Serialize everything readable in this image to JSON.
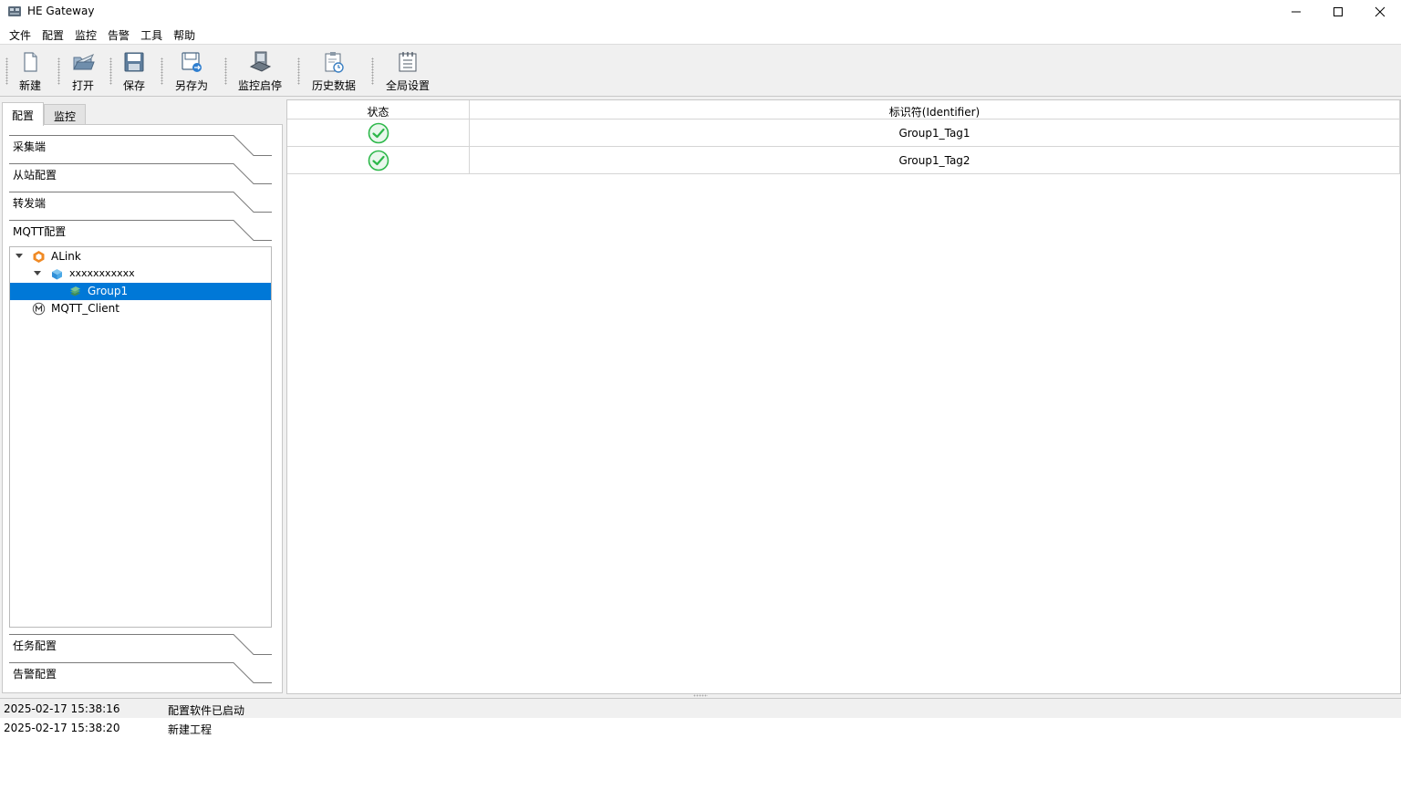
{
  "window": {
    "title": "HE Gateway"
  },
  "menu": [
    "文件",
    "配置",
    "监控",
    "告警",
    "工具",
    "帮助"
  ],
  "toolbar": [
    {
      "label": "新建",
      "icon": "new-file-icon"
    },
    {
      "label": "打开",
      "icon": "open-folder-icon"
    },
    {
      "label": "保存",
      "icon": "save-icon"
    },
    {
      "label": "另存为",
      "icon": "save-as-icon"
    },
    {
      "label": "监控启停",
      "icon": "monitor-toggle-icon"
    },
    {
      "label": "历史数据",
      "icon": "history-data-icon"
    },
    {
      "label": "全局设置",
      "icon": "global-settings-icon"
    }
  ],
  "left_tabs": [
    {
      "label": "配置",
      "active": true
    },
    {
      "label": "监控",
      "active": false
    }
  ],
  "sections_top": [
    "采集端",
    "从站配置",
    "转发端",
    "MQTT配置"
  ],
  "sections_bottom": [
    "任务配置",
    "告警配置"
  ],
  "tree": [
    {
      "label": "ALink",
      "level": 0,
      "expanded": true,
      "icon": "alink-icon"
    },
    {
      "label": "xxxxxxxxxxx",
      "level": 1,
      "expanded": true,
      "icon": "device-cube-icon"
    },
    {
      "label": "Group1",
      "level": 2,
      "selected": true,
      "icon": "group-icon"
    },
    {
      "label": "MQTT_Client",
      "level": 0,
      "icon": "mqtt-client-icon"
    }
  ],
  "grid": {
    "columns": [
      "状态",
      "标识符(Identifier)"
    ],
    "rows": [
      {
        "status": "ok",
        "identifier": "Group1_Tag1"
      },
      {
        "status": "ok",
        "identifier": "Group1_Tag2"
      }
    ]
  },
  "log": [
    {
      "time": "2025-02-17 15:38:16",
      "message": "配置软件已启动"
    },
    {
      "time": "2025-02-17 15:38:20",
      "message": "新建工程"
    }
  ],
  "colors": {
    "selection": "#0078d7",
    "status_ok": "#2db84a"
  }
}
